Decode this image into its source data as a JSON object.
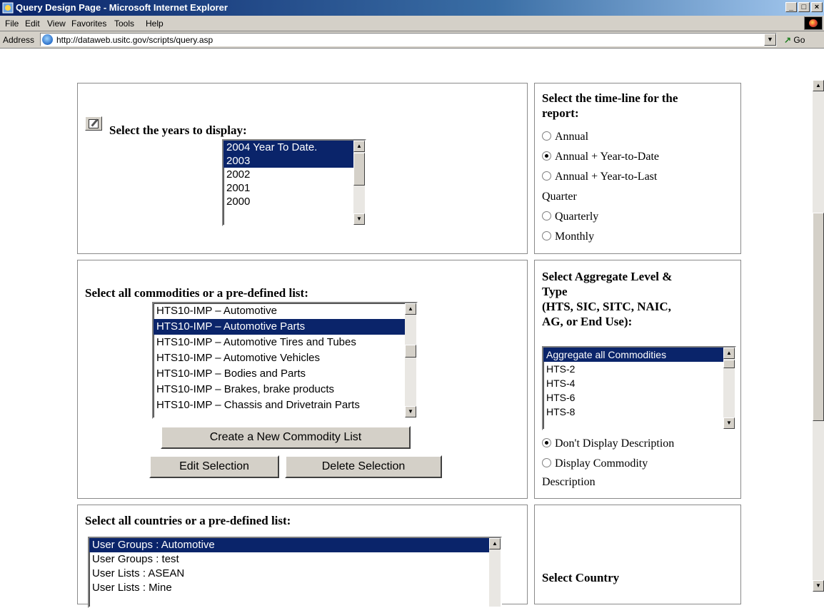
{
  "window": {
    "title": "Query Design Page - Microsoft Internet Explorer",
    "min": "_",
    "max": "□",
    "close": "×"
  },
  "menu": [
    {
      "label": "File"
    },
    {
      "label": "Edit"
    },
    {
      "label": "View"
    },
    {
      "label": "Favorites"
    },
    {
      "label": "Tools"
    },
    {
      "label": "Help"
    }
  ],
  "address": {
    "label": "Address",
    "url": "http://dataweb.usitc.gov/scripts/query.asp",
    "go": "Go"
  },
  "years": {
    "heading": "Select the years to display:",
    "options": [
      {
        "label": "2004 Year To Date.",
        "selected": true
      },
      {
        "label": "2003",
        "selected": true
      },
      {
        "label": "2002",
        "selected": false
      },
      {
        "label": "2001",
        "selected": false
      },
      {
        "label": "2000",
        "selected": false
      }
    ]
  },
  "timeline": {
    "heading_1": "Select the time-line for the",
    "heading_2": "report:",
    "options": [
      {
        "label": "Annual",
        "checked": false
      },
      {
        "label": "Annual + Year-to-Date",
        "checked": true
      },
      {
        "label": "Annual + Year-to-Last",
        "checked": false
      },
      {
        "label": "Quarter",
        "continuation": true
      },
      {
        "label": "Quarterly",
        "checked": false
      },
      {
        "label": "Monthly",
        "checked": false
      }
    ]
  },
  "commodities": {
    "heading": "Select all commodities or a pre-defined list:",
    "options": [
      {
        "label": "HTS10-IMP – Automotive",
        "selected": false
      },
      {
        "label": "HTS10-IMP – Automotive Parts",
        "selected": true
      },
      {
        "label": "HTS10-IMP – Automotive Tires and Tubes",
        "selected": false
      },
      {
        "label": "HTS10-IMP – Automotive Vehicles",
        "selected": false
      },
      {
        "label": "HTS10-IMP – Bodies and Parts",
        "selected": false
      },
      {
        "label": "HTS10-IMP – Brakes, brake products",
        "selected": false
      },
      {
        "label": "HTS10-IMP – Chassis and Drivetrain Parts",
        "selected": false
      }
    ],
    "create_button": "Create a New Commodity List",
    "edit_button": "Edit Selection",
    "delete_button": "Delete Selection"
  },
  "aggregate": {
    "heading_1": "Select Aggregate Level &",
    "heading_2": "Type",
    "heading_3": "(HTS, SIC, SITC, NAIC,",
    "heading_4": "AG, or End Use):",
    "options": [
      {
        "label": "Aggregate all Commodities",
        "selected": true
      },
      {
        "label": "HTS-2",
        "selected": false
      },
      {
        "label": "HTS-4",
        "selected": false
      },
      {
        "label": "HTS-6",
        "selected": false
      },
      {
        "label": "HTS-8",
        "selected": false
      }
    ],
    "desc_off": "Don't Display Description",
    "desc_on": "Display Commodity",
    "desc_on_2": "Description"
  },
  "countries": {
    "heading": "Select all countries or a pre-defined list:",
    "options": [
      {
        "label": "User Groups : Automotive",
        "selected": true
      },
      {
        "label": "User Groups : test",
        "selected": false
      },
      {
        "label": "User Lists : ASEAN",
        "selected": false
      },
      {
        "label": "User Lists : Mine",
        "selected": false
      }
    ]
  },
  "country": {
    "heading": "Select Country"
  }
}
